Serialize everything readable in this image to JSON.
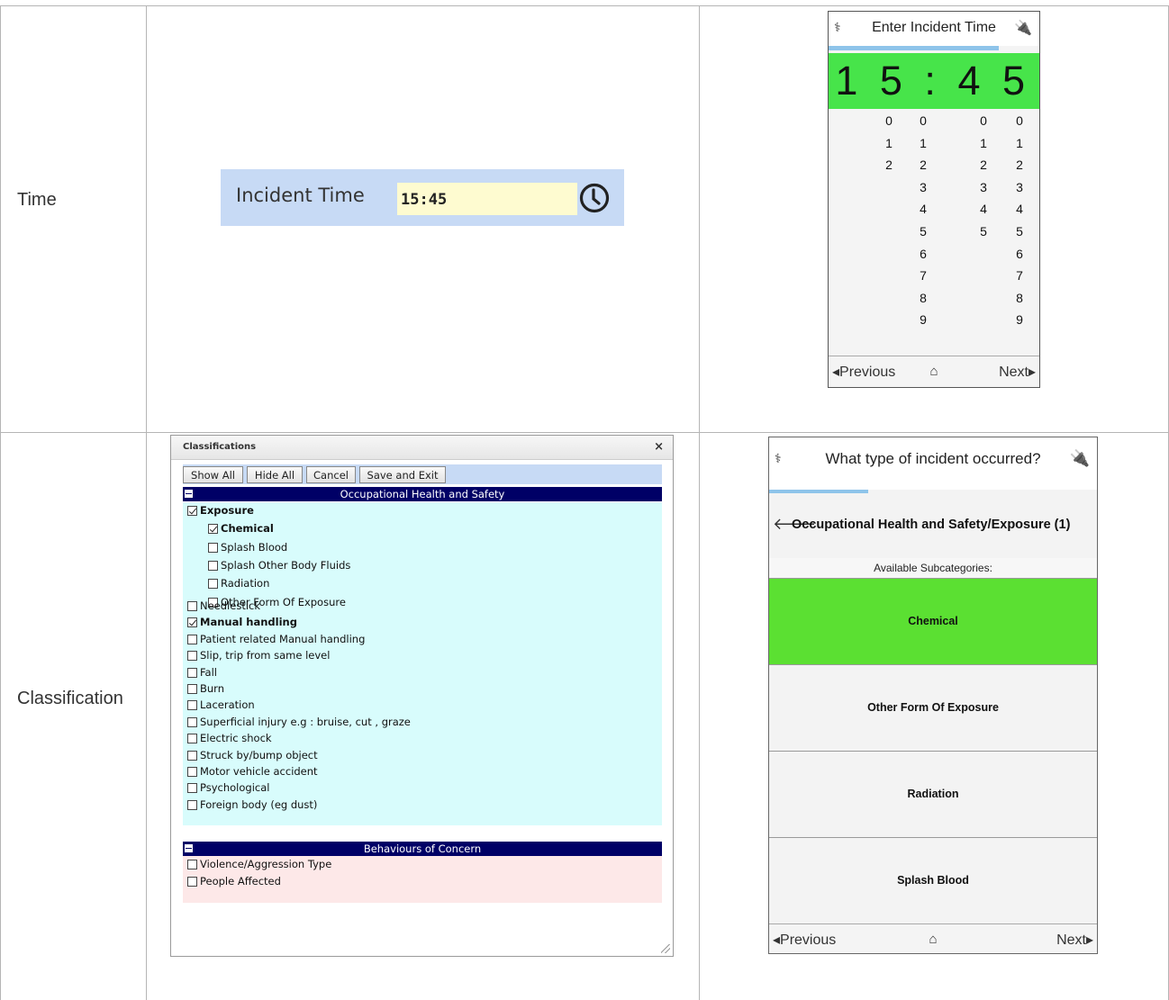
{
  "rows": [
    {
      "label": "Time"
    },
    {
      "label": "Classification"
    }
  ],
  "time_field": {
    "label": "Incident Time",
    "value": "15:45",
    "icon": "clock-icon"
  },
  "time_picker": {
    "title": "Enter Incident Time",
    "left_icon": "caduceus-icon",
    "right_icon": "plug-icon",
    "progress_percent": 80,
    "display": "15:45",
    "digit_columns": [
      [
        "0",
        "1",
        "2"
      ],
      [
        "0",
        "1",
        "2",
        "3",
        "4",
        "5",
        "6",
        "7",
        "8",
        "9"
      ],
      [
        "0",
        "1",
        "2",
        "3",
        "4",
        "5"
      ],
      [
        "0",
        "1",
        "2",
        "3",
        "4",
        "5",
        "6",
        "7",
        "8",
        "9"
      ]
    ],
    "footer": {
      "previous": "Previous",
      "next": "Next",
      "home_icon": "home-icon"
    }
  },
  "classifications_dialog": {
    "title": "Classifications",
    "close": "×",
    "buttons": {
      "show_all": "Show All",
      "hide_all": "Hide All",
      "cancel": "Cancel",
      "save_exit": "Save and Exit"
    },
    "sections": [
      {
        "title": "Occupational Health and Safety"
      },
      {
        "title": "Behaviours of Concern"
      }
    ],
    "ohs_items": [
      {
        "label": "Exposure",
        "checked": true,
        "bold": true,
        "level": 0
      },
      {
        "label": "Chemical",
        "checked": true,
        "bold": true,
        "level": 1
      },
      {
        "label": "Splash Blood",
        "checked": false,
        "bold": false,
        "level": 1
      },
      {
        "label": "Splash Other Body Fluids",
        "checked": false,
        "bold": false,
        "level": 1
      },
      {
        "label": "Radiation",
        "checked": false,
        "bold": false,
        "level": 1
      },
      {
        "label": "Other Form Of Exposure",
        "checked": false,
        "bold": false,
        "level": 1
      },
      {
        "label": "Needlestick",
        "checked": false,
        "bold": false,
        "level": 0
      },
      {
        "label": "Manual handling",
        "checked": true,
        "bold": true,
        "level": 0
      },
      {
        "label": "Patient related Manual handling",
        "checked": false,
        "bold": false,
        "level": 0
      },
      {
        "label": "Slip, trip from same level",
        "checked": false,
        "bold": false,
        "level": 0
      },
      {
        "label": "Fall",
        "checked": false,
        "bold": false,
        "level": 0
      },
      {
        "label": "Burn",
        "checked": false,
        "bold": false,
        "level": 0
      },
      {
        "label": "Laceration",
        "checked": false,
        "bold": false,
        "level": 0
      },
      {
        "label": "Superficial injury e.g : bruise, cut , graze",
        "checked": false,
        "bold": false,
        "level": 0
      },
      {
        "label": "Electric shock",
        "checked": false,
        "bold": false,
        "level": 0
      },
      {
        "label": "Struck by/bump object",
        "checked": false,
        "bold": false,
        "level": 0
      },
      {
        "label": "Motor vehicle accident",
        "checked": false,
        "bold": false,
        "level": 0
      },
      {
        "label": "Psychological",
        "checked": false,
        "bold": false,
        "level": 0
      },
      {
        "label": "Foreign body (eg dust)",
        "checked": false,
        "bold": false,
        "level": 0
      }
    ],
    "boc_items": [
      {
        "label": "Violence/Aggression Type",
        "checked": false
      },
      {
        "label": "People Affected",
        "checked": false
      }
    ]
  },
  "mobile_classification": {
    "title": "What type of incident occurred?",
    "left_icon": "caduceus-icon",
    "right_icon": "plug-icon",
    "progress_percent": 30,
    "breadcrumb": "Occupational Health and Safety/Exposure (1)",
    "available_header": "Available Subcategories:",
    "options": [
      {
        "label": "Chemical",
        "selected": true
      },
      {
        "label": "Other Form Of Exposure",
        "selected": false
      },
      {
        "label": "Radiation",
        "selected": false
      },
      {
        "label": "Splash Blood",
        "selected": false
      }
    ],
    "footer": {
      "previous": "Previous",
      "next": "Next",
      "home_icon": "home-icon"
    }
  },
  "colors": {
    "time_field_bg": "#c7daf5",
    "time_value_bg": "#fefbd0",
    "picker_green": "#47e44a",
    "selected_green": "#5be032",
    "section_header": "#000066",
    "ohs_panel": "#d8fcfc",
    "boc_panel": "#fde8e8"
  }
}
